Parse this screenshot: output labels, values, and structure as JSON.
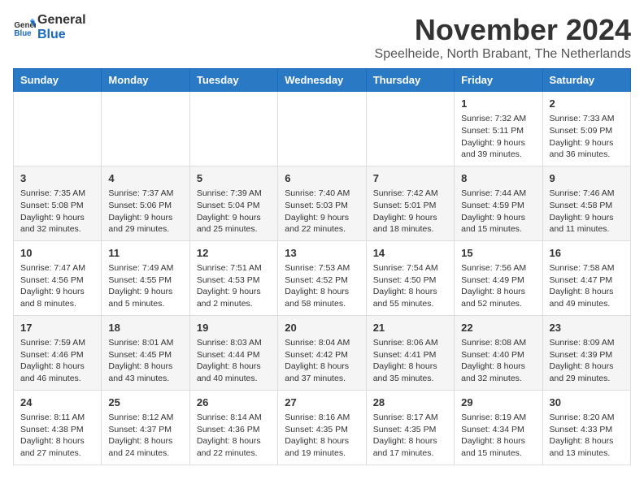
{
  "logo": {
    "text_general": "General",
    "text_blue": "Blue"
  },
  "header": {
    "month_title": "November 2024",
    "location": "Speelheide, North Brabant, The Netherlands"
  },
  "days_of_week": [
    "Sunday",
    "Monday",
    "Tuesday",
    "Wednesday",
    "Thursday",
    "Friday",
    "Saturday"
  ],
  "weeks": [
    [
      {
        "day": "",
        "info": ""
      },
      {
        "day": "",
        "info": ""
      },
      {
        "day": "",
        "info": ""
      },
      {
        "day": "",
        "info": ""
      },
      {
        "day": "",
        "info": ""
      },
      {
        "day": "1",
        "info": "Sunrise: 7:32 AM\nSunset: 5:11 PM\nDaylight: 9 hours and 39 minutes."
      },
      {
        "day": "2",
        "info": "Sunrise: 7:33 AM\nSunset: 5:09 PM\nDaylight: 9 hours and 36 minutes."
      }
    ],
    [
      {
        "day": "3",
        "info": "Sunrise: 7:35 AM\nSunset: 5:08 PM\nDaylight: 9 hours and 32 minutes."
      },
      {
        "day": "4",
        "info": "Sunrise: 7:37 AM\nSunset: 5:06 PM\nDaylight: 9 hours and 29 minutes."
      },
      {
        "day": "5",
        "info": "Sunrise: 7:39 AM\nSunset: 5:04 PM\nDaylight: 9 hours and 25 minutes."
      },
      {
        "day": "6",
        "info": "Sunrise: 7:40 AM\nSunset: 5:03 PM\nDaylight: 9 hours and 22 minutes."
      },
      {
        "day": "7",
        "info": "Sunrise: 7:42 AM\nSunset: 5:01 PM\nDaylight: 9 hours and 18 minutes."
      },
      {
        "day": "8",
        "info": "Sunrise: 7:44 AM\nSunset: 4:59 PM\nDaylight: 9 hours and 15 minutes."
      },
      {
        "day": "9",
        "info": "Sunrise: 7:46 AM\nSunset: 4:58 PM\nDaylight: 9 hours and 11 minutes."
      }
    ],
    [
      {
        "day": "10",
        "info": "Sunrise: 7:47 AM\nSunset: 4:56 PM\nDaylight: 9 hours and 8 minutes."
      },
      {
        "day": "11",
        "info": "Sunrise: 7:49 AM\nSunset: 4:55 PM\nDaylight: 9 hours and 5 minutes."
      },
      {
        "day": "12",
        "info": "Sunrise: 7:51 AM\nSunset: 4:53 PM\nDaylight: 9 hours and 2 minutes."
      },
      {
        "day": "13",
        "info": "Sunrise: 7:53 AM\nSunset: 4:52 PM\nDaylight: 8 hours and 58 minutes."
      },
      {
        "day": "14",
        "info": "Sunrise: 7:54 AM\nSunset: 4:50 PM\nDaylight: 8 hours and 55 minutes."
      },
      {
        "day": "15",
        "info": "Sunrise: 7:56 AM\nSunset: 4:49 PM\nDaylight: 8 hours and 52 minutes."
      },
      {
        "day": "16",
        "info": "Sunrise: 7:58 AM\nSunset: 4:47 PM\nDaylight: 8 hours and 49 minutes."
      }
    ],
    [
      {
        "day": "17",
        "info": "Sunrise: 7:59 AM\nSunset: 4:46 PM\nDaylight: 8 hours and 46 minutes."
      },
      {
        "day": "18",
        "info": "Sunrise: 8:01 AM\nSunset: 4:45 PM\nDaylight: 8 hours and 43 minutes."
      },
      {
        "day": "19",
        "info": "Sunrise: 8:03 AM\nSunset: 4:44 PM\nDaylight: 8 hours and 40 minutes."
      },
      {
        "day": "20",
        "info": "Sunrise: 8:04 AM\nSunset: 4:42 PM\nDaylight: 8 hours and 37 minutes."
      },
      {
        "day": "21",
        "info": "Sunrise: 8:06 AM\nSunset: 4:41 PM\nDaylight: 8 hours and 35 minutes."
      },
      {
        "day": "22",
        "info": "Sunrise: 8:08 AM\nSunset: 4:40 PM\nDaylight: 8 hours and 32 minutes."
      },
      {
        "day": "23",
        "info": "Sunrise: 8:09 AM\nSunset: 4:39 PM\nDaylight: 8 hours and 29 minutes."
      }
    ],
    [
      {
        "day": "24",
        "info": "Sunrise: 8:11 AM\nSunset: 4:38 PM\nDaylight: 8 hours and 27 minutes."
      },
      {
        "day": "25",
        "info": "Sunrise: 8:12 AM\nSunset: 4:37 PM\nDaylight: 8 hours and 24 minutes."
      },
      {
        "day": "26",
        "info": "Sunrise: 8:14 AM\nSunset: 4:36 PM\nDaylight: 8 hours and 22 minutes."
      },
      {
        "day": "27",
        "info": "Sunrise: 8:16 AM\nSunset: 4:35 PM\nDaylight: 8 hours and 19 minutes."
      },
      {
        "day": "28",
        "info": "Sunrise: 8:17 AM\nSunset: 4:35 PM\nDaylight: 8 hours and 17 minutes."
      },
      {
        "day": "29",
        "info": "Sunrise: 8:19 AM\nSunset: 4:34 PM\nDaylight: 8 hours and 15 minutes."
      },
      {
        "day": "30",
        "info": "Sunrise: 8:20 AM\nSunset: 4:33 PM\nDaylight: 8 hours and 13 minutes."
      }
    ]
  ]
}
